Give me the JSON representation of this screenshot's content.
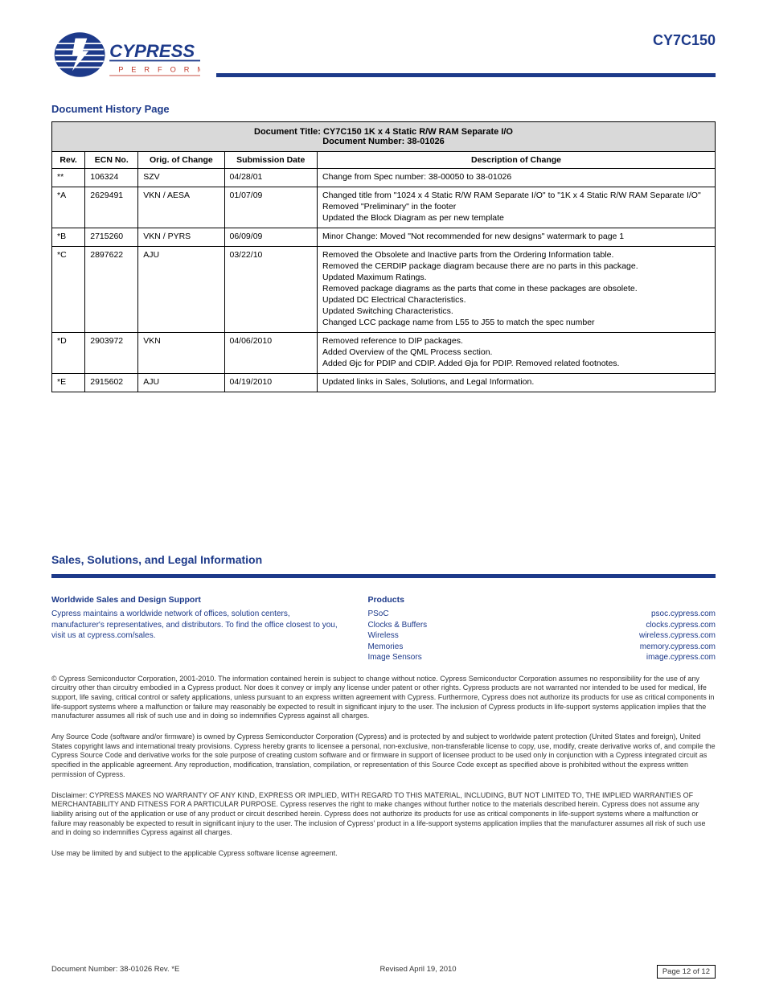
{
  "product_code": "CY7C150",
  "section_title": "Document History Page",
  "table": {
    "title": "Document Title: CY7C150 1K x 4 Static R/W RAM Separate I/O",
    "doc_no": "Document Number: 38-01026",
    "headers": [
      "Rev.",
      "ECN No.",
      "Orig. of Change",
      "Submission Date",
      "Description of Change"
    ],
    "rows": [
      {
        "rev": "**",
        "ecn": "106324",
        "oc": "SZV",
        "date": "04/28/01",
        "desc": [
          "Change from Spec number: 38-00050 to 38-01026"
        ]
      },
      {
        "rev": "*A",
        "ecn": "2629491",
        "oc": "VKN / AESA",
        "date": "01/07/09",
        "desc": [
          "Changed title from \"1024 x 4 Static R/W RAM Separate I/O\" to \"1K x 4 Static R/W RAM Separate I/O\"",
          "Removed \"Preliminary\" in the footer",
          "Updated the Block Diagram as per new template"
        ]
      },
      {
        "rev": "*B",
        "ecn": "2715260",
        "oc": "VKN / PYRS",
        "date": "06/09/09",
        "desc": [
          "Minor Change: Moved \"Not recommended for new designs\" watermark to page 1"
        ]
      },
      {
        "rev": "*C",
        "ecn": "2897622",
        "oc": "AJU",
        "date": "03/22/10",
        "desc": [
          "Removed the Obsolete and Inactive parts from the Ordering Information table.",
          "Removed the CERDIP package diagram because there are no parts in this package.",
          "Updated Maximum Ratings.",
          "Removed package diagrams as the parts that come in these packages are obsolete.",
          "Updated DC Electrical Characteristics.",
          "Updated Switching Characteristics.",
          "Changed LCC package name from L55 to J55 to match the spec number"
        ]
      },
      {
        "rev": "*D",
        "ecn": "2903972",
        "oc": "VKN",
        "date": "04/06/2010",
        "desc": [
          "Removed reference to DIP packages.",
          "Added Overview of the QML Process section.",
          "Added Θjc for PDIP and CDIP. Added Θja for PDIP. Removed related footnotes."
        ]
      },
      {
        "rev": "*E",
        "ecn": "2915602",
        "oc": "AJU",
        "date": "04/19/2010",
        "desc": [
          "Updated links in Sales, Solutions, and Legal Information."
        ]
      }
    ]
  },
  "sales_title": "Sales, Solutions, and Legal Information",
  "sales": {
    "left": {
      "hd1": "Worldwide Sales and Design Support",
      "p1": "Cypress maintains a worldwide network of offices, solution centers, manufacturer's representatives, and distributors. To find the office closest to you, visit us at cypress.com/sales."
    },
    "right": {
      "hd1": "Products",
      "items": [
        [
          "PSoC",
          "psoc.cypress.com"
        ],
        [
          "Clocks & Buffers",
          "clocks.cypress.com"
        ],
        [
          "Wireless",
          "wireless.cypress.com"
        ],
        [
          "Memories",
          "memory.cypress.com"
        ],
        [
          "Image Sensors",
          "image.cypress.com"
        ]
      ]
    }
  },
  "copyright": "© Cypress Semiconductor Corporation, 2001-2010. The information contained herein is subject to change without notice. Cypress Semiconductor Corporation assumes no responsibility for the use of any circuitry other than circuitry embodied in a Cypress product. Nor does it convey or imply any license under patent or other rights. Cypress products are not warranted nor intended to be used for medical, life support, life saving, critical control or safety applications, unless pursuant to an express written agreement with Cypress. Furthermore, Cypress does not authorize its products for use as critical components in life-support systems where a malfunction or failure may reasonably be expected to result in significant injury to the user. The inclusion of Cypress products in life-support systems application implies that the manufacturer assumes all risk of such use and in doing so indemnifies Cypress against all charges.",
  "trademark": "Any Source Code (software and/or firmware) is owned by Cypress Semiconductor Corporation (Cypress) and is protected by and subject to worldwide patent protection (United States and foreign), United States copyright laws and international treaty provisions. Cypress hereby grants to licensee a personal, non-exclusive, non-transferable license to copy, use, modify, create derivative works of, and compile the Cypress Source Code and derivative works for the sole purpose of creating custom software and or firmware in support of licensee product to be used only in conjunction with a Cypress integrated circuit as specified in the applicable agreement. Any reproduction, modification, translation, compilation, or representation of this Source Code except as specified above is prohibited without the express written permission of Cypress.",
  "disclaimer": "Disclaimer: CYPRESS MAKES NO WARRANTY OF ANY KIND, EXPRESS OR IMPLIED, WITH REGARD TO THIS MATERIAL, INCLUDING, BUT NOT LIMITED TO, THE IMPLIED WARRANTIES OF MERCHANTABILITY AND FITNESS FOR A PARTICULAR PURPOSE. Cypress reserves the right to make changes without further notice to the materials described herein. Cypress does not assume any liability arising out of the application or use of any product or circuit described herein. Cypress does not authorize its products for use as critical components in life-support systems where a malfunction or failure may reasonably be expected to result in significant injury to the user. The inclusion of Cypress' product in a life-support systems application implies that the manufacturer assumes all risk of such use and in doing so indemnifies Cypress against all charges.",
  "use_agree": "Use may be limited by and subject to the applicable Cypress software license agreement.",
  "footer": {
    "left": "Document Number: 38-01026 Rev. *E",
    "center": "Revised April 19, 2010",
    "right": "Page 12 of 12"
  }
}
